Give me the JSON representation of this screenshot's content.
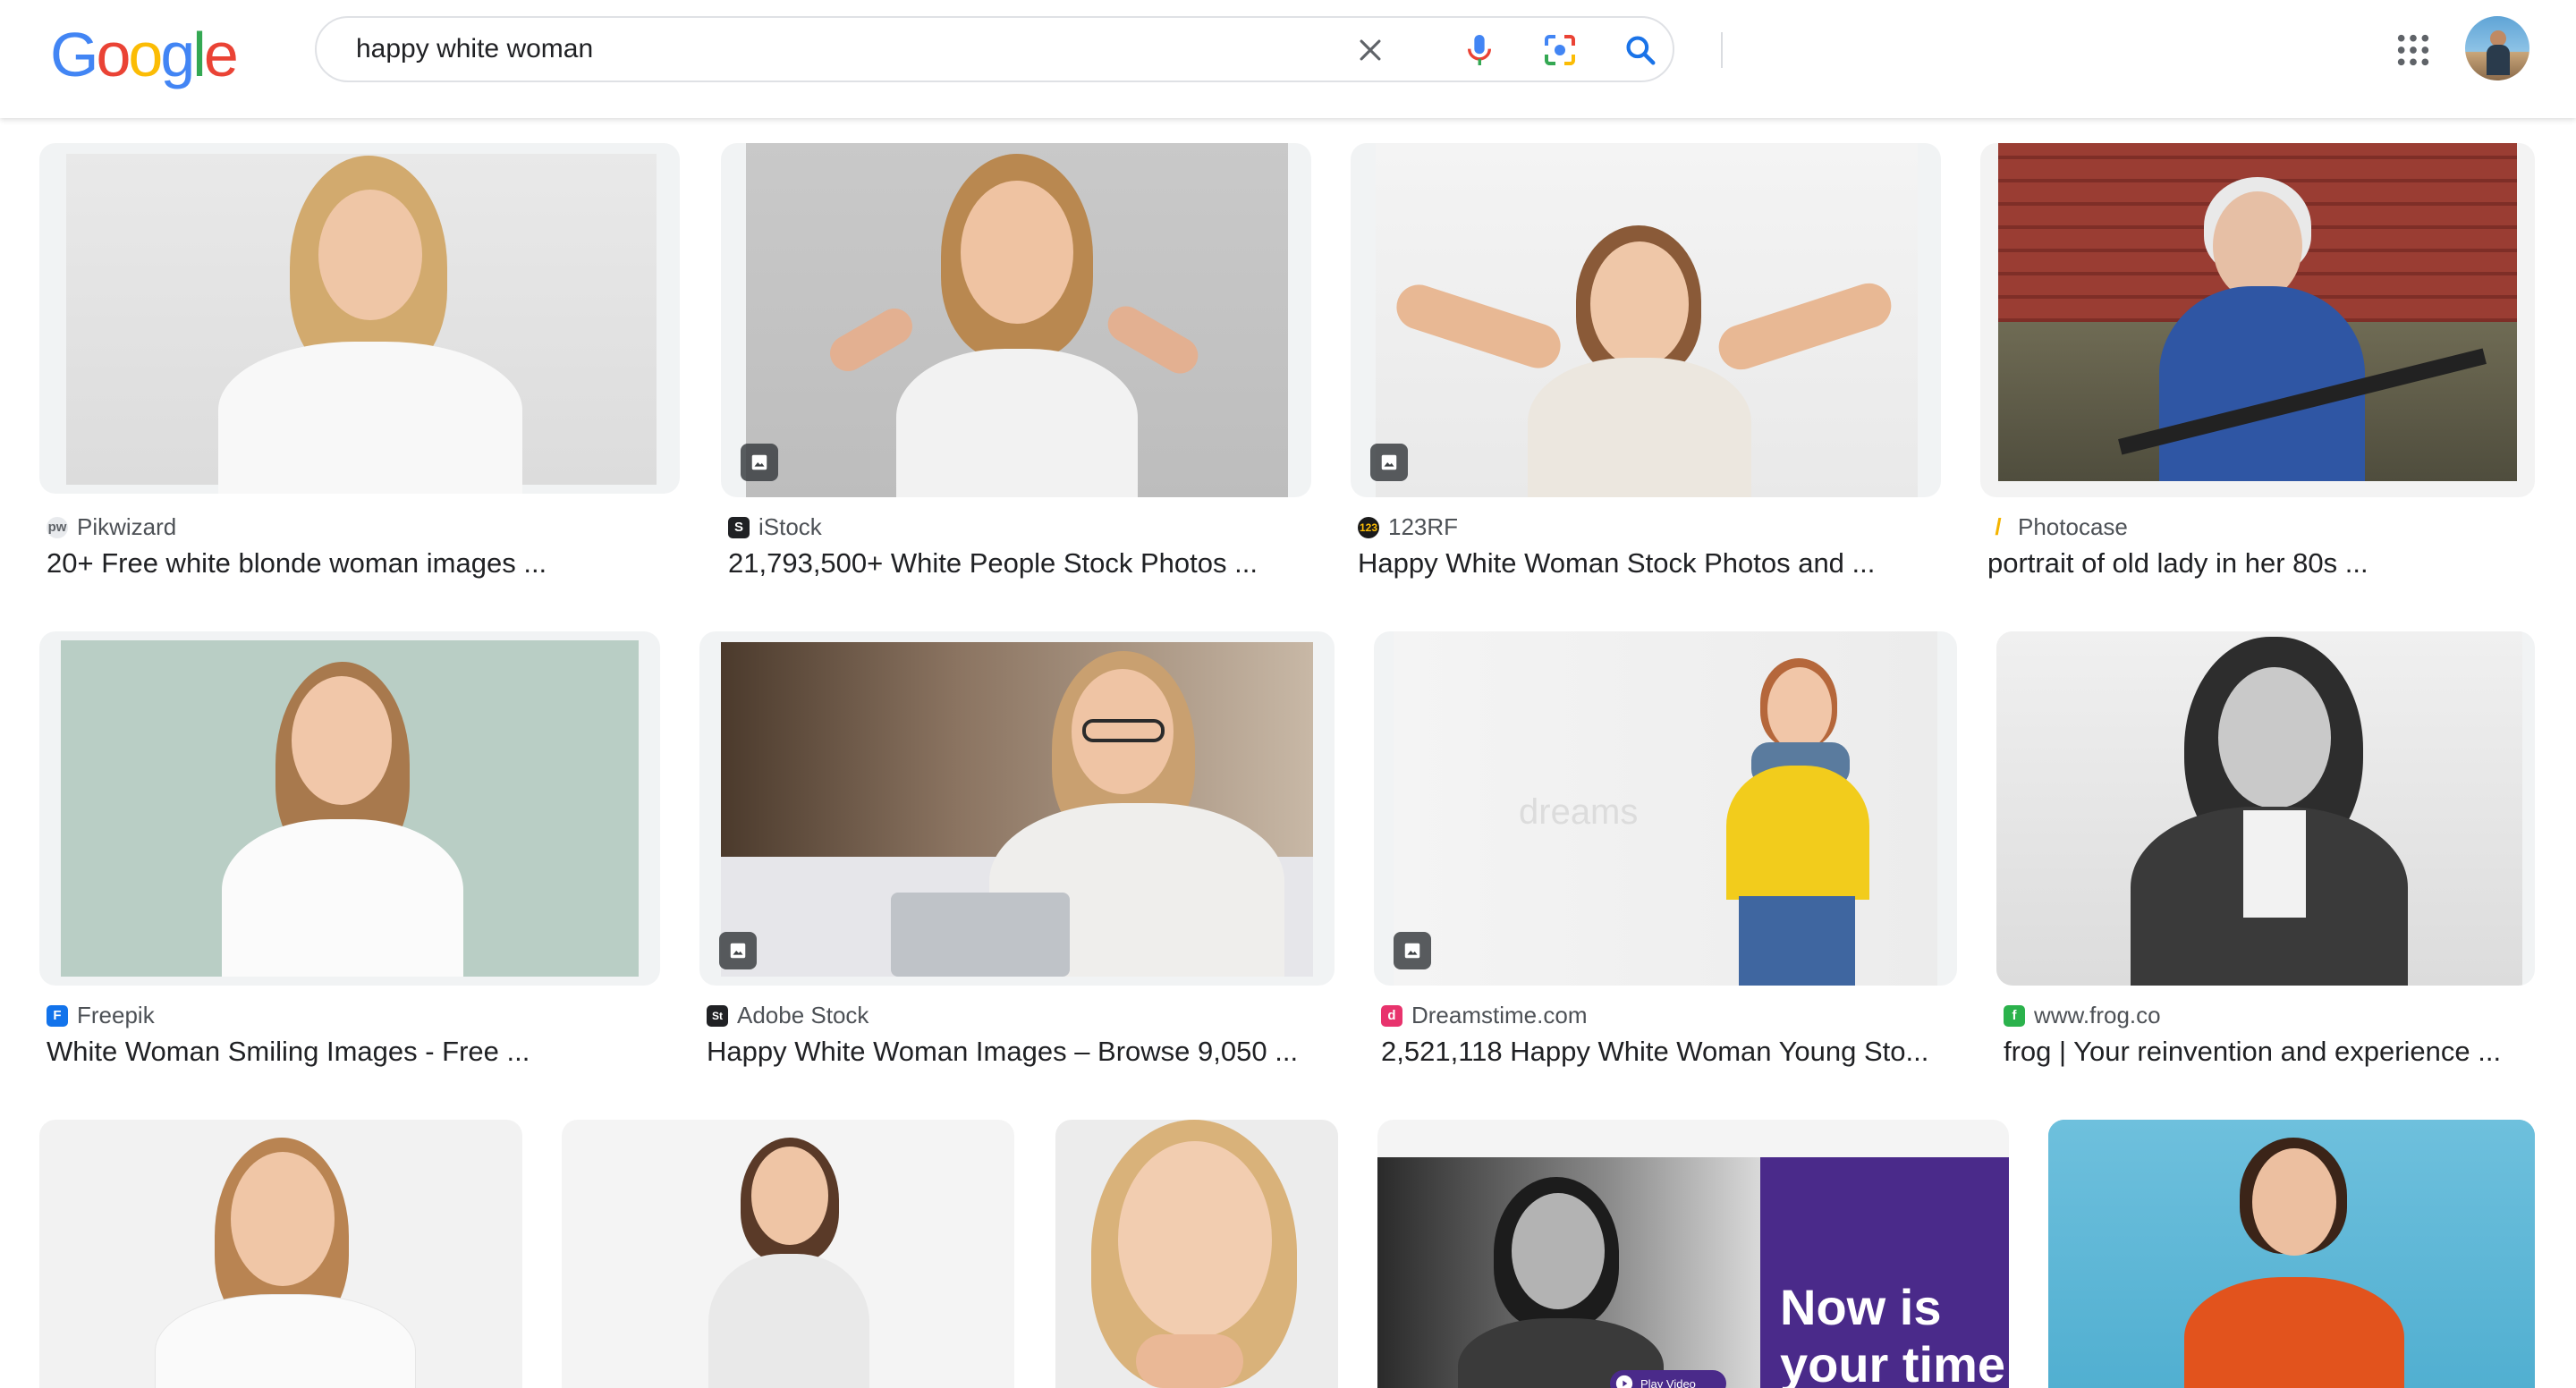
{
  "search": {
    "query": "happy white woman"
  },
  "logo": {
    "letters": [
      "G",
      "o",
      "o",
      "g",
      "l",
      "e"
    ],
    "colors": [
      "#4285F4",
      "#EA4335",
      "#FBBC05",
      "#4285F4",
      "#34A853",
      "#EA4335"
    ]
  },
  "icons": {
    "clear": "close-icon",
    "voice": "microphone-icon",
    "lens": "camera-lens-icon",
    "search": "search-icon",
    "apps": "apps-grid-icon"
  },
  "results": [
    {
      "source": "Pikwizard",
      "title": "20+ Free white blonde woman images ...",
      "favicon": "#9aa0a6",
      "favicon_text": "pw"
    },
    {
      "source": "iStock",
      "title": "21,793,500+ White People Stock Photos ...",
      "favicon": "#202124",
      "favicon_text": "S"
    },
    {
      "source": "123RF",
      "title": "Happy White Woman Stock Photos and ...",
      "favicon": "#1a1a1a",
      "favicon_text": "1"
    },
    {
      "source": "Photocase",
      "title": "portrait of old lady in her 80s ...",
      "favicon": "#f4b400",
      "favicon_text": "/"
    },
    {
      "source": "Freepik",
      "title": "White Woman Smiling Images - Free ...",
      "favicon": "#1273eb",
      "favicon_text": "F"
    },
    {
      "source": "Adobe Stock",
      "title": "Happy White Woman Images – Browse 9,050 ...",
      "favicon": "#202124",
      "favicon_text": "St"
    },
    {
      "source": "Dreamstime.com",
      "title": "2,521,118 Happy White Woman Young Sto...",
      "favicon": "#e8336d",
      "favicon_text": "d"
    },
    {
      "source": "www.frog.co",
      "title": "frog | Your reinvention and experience ...",
      "favicon": "#2bb24c",
      "favicon_text": "f"
    }
  ],
  "promo": {
    "line1": "Now is",
    "line2": "your time",
    "video_label": "Play Video"
  },
  "colors": {
    "accent_blue": "#1a73e8",
    "text_primary": "#202124",
    "text_secondary": "#4d5156",
    "promo_purple": "#4a2a8a"
  }
}
